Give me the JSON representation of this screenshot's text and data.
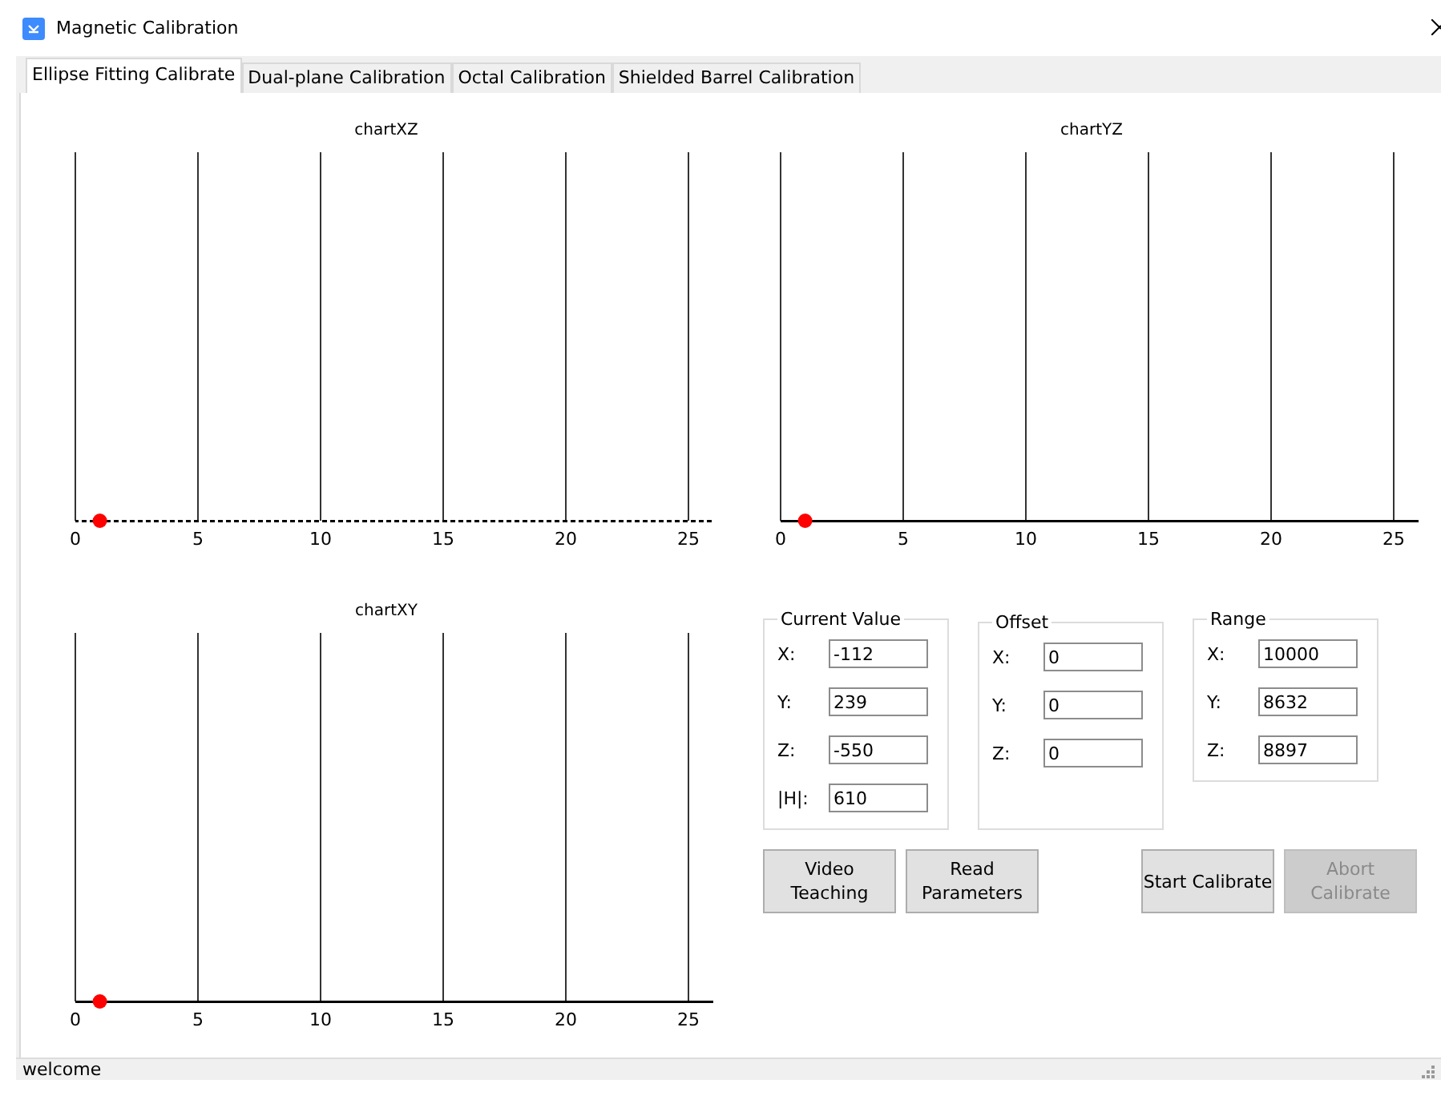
{
  "window": {
    "title": "Magnetic Calibration"
  },
  "tabs": [
    {
      "label": "Ellipse Fitting Calibrate",
      "selected": true
    },
    {
      "label": "Dual-plane Calibration",
      "selected": false
    },
    {
      "label": "Octal Calibration",
      "selected": false
    },
    {
      "label": "Shielded Barrel Calibration",
      "selected": false
    }
  ],
  "charts": [
    {
      "title": "chartXZ",
      "dashed_axis": true,
      "x_ticks": [
        "0",
        "5",
        "10",
        "15",
        "20",
        "25"
      ]
    },
    {
      "title": "chartYZ",
      "dashed_axis": false,
      "x_ticks": [
        "0",
        "5",
        "10",
        "15",
        "20",
        "25"
      ]
    },
    {
      "title": "chartXY",
      "dashed_axis": false,
      "x_ticks": [
        "0",
        "5",
        "10",
        "15",
        "20",
        "25"
      ]
    }
  ],
  "groups": [
    {
      "title": "Current Value",
      "fields": [
        {
          "label": "X:",
          "value": "-112"
        },
        {
          "label": "Y:",
          "value": "239"
        },
        {
          "label": "Z:",
          "value": "-550"
        },
        {
          "label": "|H|:",
          "value": "610"
        }
      ]
    },
    {
      "title": "Offset",
      "fields": [
        {
          "label": "X:",
          "value": "0"
        },
        {
          "label": "Y:",
          "value": "0"
        },
        {
          "label": "Z:",
          "value": "0"
        }
      ]
    },
    {
      "title": "Range",
      "fields": [
        {
          "label": "X:",
          "value": "10000"
        },
        {
          "label": "Y:",
          "value": "8632"
        },
        {
          "label": "Z:",
          "value": "8897"
        }
      ]
    }
  ],
  "buttons": [
    {
      "label": "Video Teaching",
      "disabled": false
    },
    {
      "label": "Read Parameters",
      "disabled": false
    },
    {
      "label": "Start Calibrate",
      "disabled": false
    },
    {
      "label": "Abort Calibrate",
      "disabled": true
    }
  ],
  "status_bar": {
    "text": "welcome"
  }
}
